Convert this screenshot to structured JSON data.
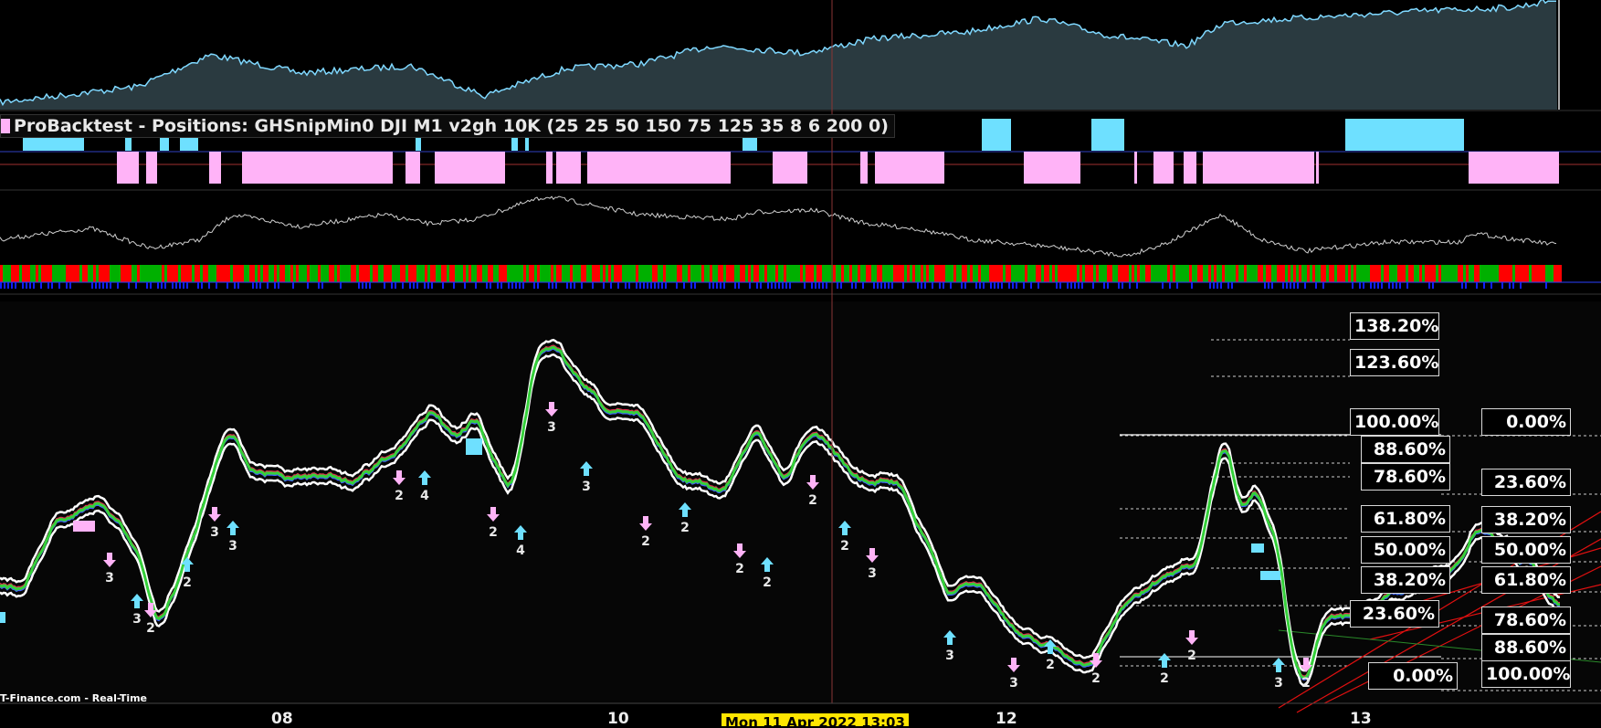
{
  "panel_title": "ProBacktest - Positions: GHSnipMin0 DJI M1 v2gh 10K (25 25 50 150 75 125 35 8 6 200 0)",
  "brand_text": "T-Finance.com - Real-Time",
  "cursor_date": "Mon 11 Apr 2022 13:03",
  "colors": {
    "background": "#000000",
    "equity_line": "#7fd8ff",
    "equity_line_down": "#ffa0f0",
    "equity_fill": "#2a3a40",
    "long_position": "#6ee0ff",
    "short_position": "#ffb3f7",
    "price_outer": "#ffffff",
    "price_ma_green": "#35d03a",
    "price_ma_red": "#e03050",
    "price_ma_blue": "#4060ff",
    "bar_red": "#ff0000",
    "bar_green": "#00b000",
    "bar_blue": "#1020ff",
    "fib_red": "#e01010",
    "crosshair": "#a04040"
  },
  "chart_data": {
    "type": "line",
    "x_tick_labels": [
      "08",
      "10",
      "12",
      "13"
    ],
    "fib_left": {
      "levels": [
        "138.20%",
        "123.60%",
        "100.00%",
        "88.60%",
        "78.60%",
        "61.80%",
        "50.00%",
        "38.20%",
        "23.60%",
        "0.00%"
      ]
    },
    "fib_right": {
      "levels": [
        "0.00%",
        "23.60%",
        "38.20%",
        "50.00%",
        "61.80%",
        "78.60%",
        "88.60%",
        "100.00%"
      ]
    },
    "trade_markers": [
      {
        "side": "short",
        "count": "3"
      },
      {
        "side": "long",
        "count": "3"
      },
      {
        "side": "short",
        "count": "2"
      },
      {
        "side": "long",
        "count": "2"
      },
      {
        "side": "short",
        "count": "3"
      },
      {
        "side": "long",
        "count": "3"
      },
      {
        "side": "short",
        "count": "2"
      },
      {
        "side": "long",
        "count": "4"
      },
      {
        "side": "short",
        "count": "2"
      },
      {
        "side": "long",
        "count": "4"
      },
      {
        "side": "short",
        "count": "3"
      },
      {
        "side": "long",
        "count": "3"
      },
      {
        "side": "short",
        "count": "2"
      },
      {
        "side": "long",
        "count": "2"
      },
      {
        "side": "short",
        "count": "2"
      },
      {
        "side": "long",
        "count": "2"
      },
      {
        "side": "short",
        "count": "2"
      },
      {
        "side": "long",
        "count": "2"
      },
      {
        "side": "short",
        "count": "3"
      },
      {
        "side": "long",
        "count": "3"
      },
      {
        "side": "short",
        "count": "3"
      },
      {
        "side": "long",
        "count": "2"
      },
      {
        "side": "short",
        "count": "2"
      },
      {
        "side": "long",
        "count": "2"
      },
      {
        "side": "short",
        "count": "2"
      },
      {
        "side": "long",
        "count": "3"
      },
      {
        "side": "short",
        "count": "2"
      }
    ]
  }
}
